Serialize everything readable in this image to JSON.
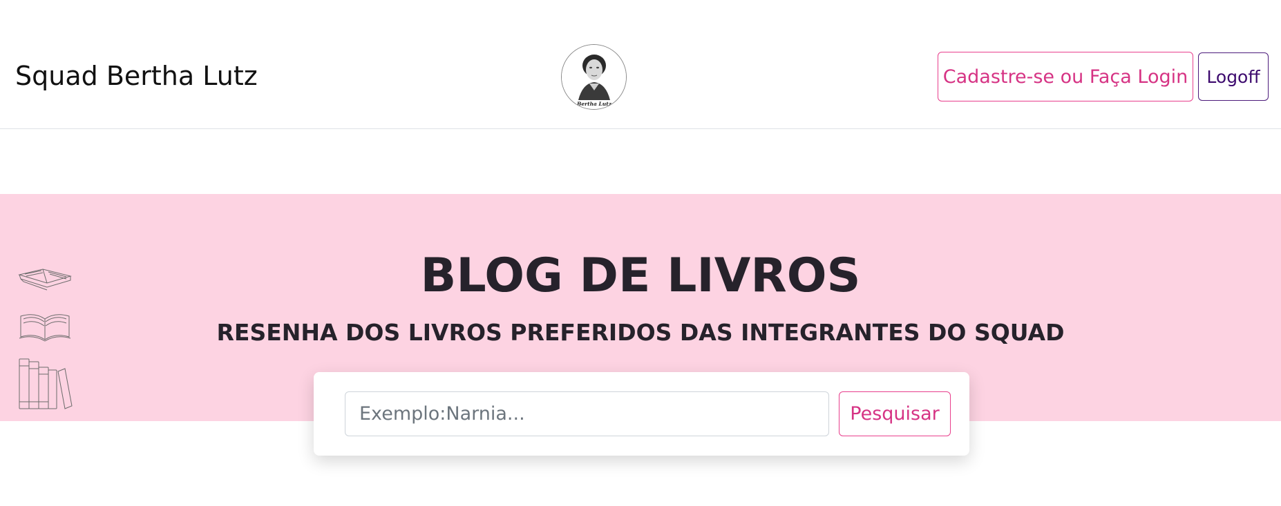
{
  "navbar": {
    "brand": "Squad Bertha Lutz",
    "logo_caption": "Bertha Lutz",
    "register_label": "Cadastre-se ou Faça Login",
    "logoff_label": "Logoff"
  },
  "hero": {
    "title": "BLOG DE LIVROS",
    "subtitle": "RESENHA DOS LIVROS PREFERIDOS DAS INTEGRANTES DO SQUAD"
  },
  "search": {
    "placeholder": "Exemplo:Narnia...",
    "value": "",
    "button_label": "Pesquisar"
  },
  "icons": {
    "side": [
      "open-book-icon",
      "open-book-pages-icon",
      "books-shelf-icon"
    ]
  },
  "colors": {
    "hero_background": "#fdd3e2",
    "accent_pink": "#d63384",
    "logoff_purple": "#3d0a6e"
  }
}
